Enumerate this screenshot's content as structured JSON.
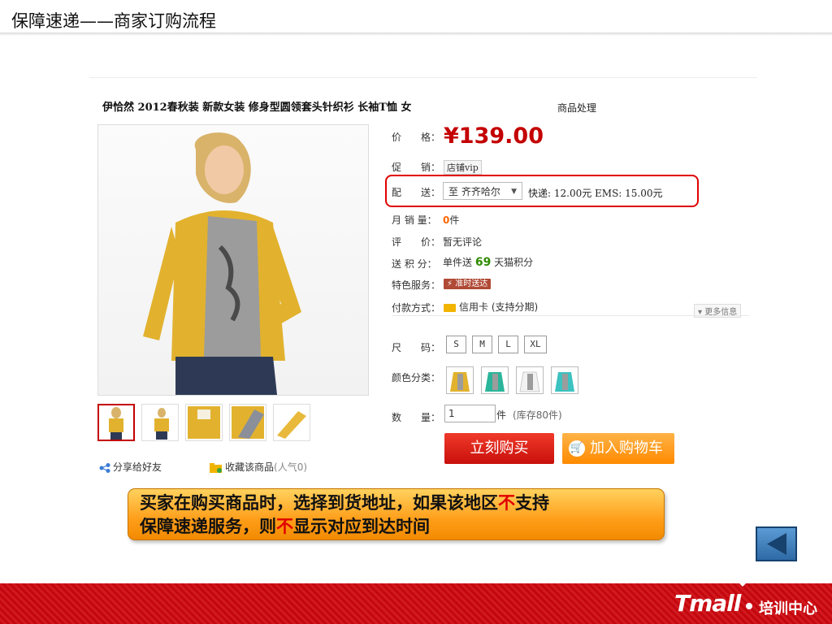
{
  "slide": {
    "title": "保障速递——商家订购流程"
  },
  "product": {
    "title": "伊恰然 2012春秋装 新款女装 修身型圆领套头针织衫 长袖T恤 女",
    "action_label": "商品处理"
  },
  "details": {
    "price_label": "价　　格：",
    "price": "¥139.00",
    "promo_label": "促　　销：",
    "promo_tag": "店铺vip",
    "delivery_label": "配　　送：",
    "destination": "至 齐齐哈尔",
    "shipping_fees": "快递: 12.00元 EMS: 15.00元",
    "monthly_sales_label": "月 销 量：",
    "monthly_sales_count": "0",
    "monthly_sales_unit": "件",
    "review_label": "评　　价：",
    "review_value": "暂无评论",
    "points_label": "送 积 分：",
    "points_prefix": "单件送",
    "points_value": "69",
    "points_suffix": "天猫积分",
    "service_label": "特色服务：",
    "service_badge": "⚡ 准时送达",
    "payment_label": "付款方式：",
    "payment_value": "信用卡 (支持分期)",
    "more_info": "▾ 更多信息",
    "size_label": "尺　　码：",
    "sizes": [
      "S",
      "M",
      "L",
      "XL"
    ],
    "color_label": "颜色分类：",
    "quantity_label": "数　　量：",
    "quantity_value": "1",
    "quantity_unit": "件",
    "stock_note": "(库存80件)"
  },
  "actions": {
    "buy_now": "立刻购买",
    "add_to_cart": "加入购物车"
  },
  "social": {
    "share": "分享给好友",
    "favorite": "收藏该商品",
    "popularity": "(人气0)"
  },
  "callout": {
    "part1": "买家在购买商品时，选择到货地址，如果该地区",
    "red1": "不",
    "part2": "支持",
    "part3": "保障速递服务，则",
    "red2": "不",
    "part4": "显示对应到达时间"
  },
  "footer": {
    "brand": "Tmall",
    "subtitle": "培训中心"
  },
  "colors": {
    "price_red": "#c40000",
    "highlight_red": "#e00000",
    "callout_orange": "#ff9e1a",
    "footer_red": "#c4070e",
    "nav_blue": "#2e6aa5"
  }
}
